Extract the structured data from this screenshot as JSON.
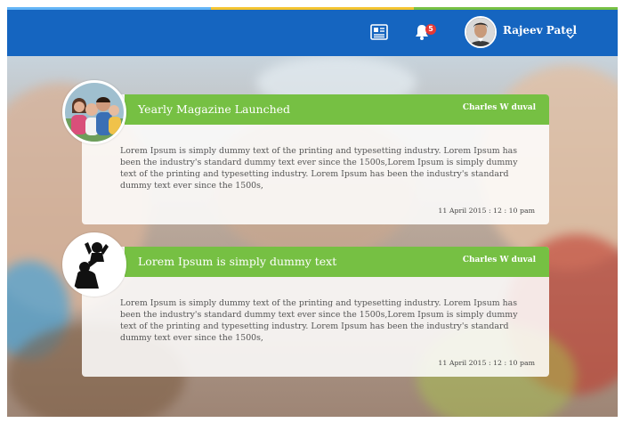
{
  "header": {
    "user_name": "Rajeev Patel",
    "notification_count": "5",
    "icons": [
      "newspaper-icon",
      "bell-icon",
      "chevron-down-icon"
    ],
    "colors": {
      "header_bg": "#1565c0",
      "strip": [
        "#64b5f6",
        "#f4c430",
        "#76c043"
      ]
    }
  },
  "posts": [
    {
      "title": "Yearly Magazine Launched",
      "author": "Charles W duval",
      "body": "Lorem Ipsum is simply dummy text of the printing and typesetting industry. Lorem Ipsum has been the industry's standard dummy text ever since the 1500s,Lorem Ipsum is simply dummy text of the printing and typesetting industry. Lorem Ipsum has been the industry's standard dummy text ever since the 1500s,",
      "date": "11 April 2015 : 12 : 10 pam",
      "thumb": "family-photo"
    },
    {
      "title": "Lorem Ipsum is simply dummy text",
      "author": "Charles W duval",
      "body": "Lorem Ipsum is simply dummy text of the printing and typesetting industry. Lorem Ipsum has been the industry's standard dummy text ever since the 1500s,Lorem Ipsum is simply dummy text of the printing and typesetting industry. Lorem Ipsum has been the industry's standard dummy text ever since the 1500s,",
      "date": "11 April 2015 : 12 : 10 pam",
      "thumb": "parent-child-silhouette"
    }
  ],
  "colors": {
    "card_bar": "#76c043"
  }
}
